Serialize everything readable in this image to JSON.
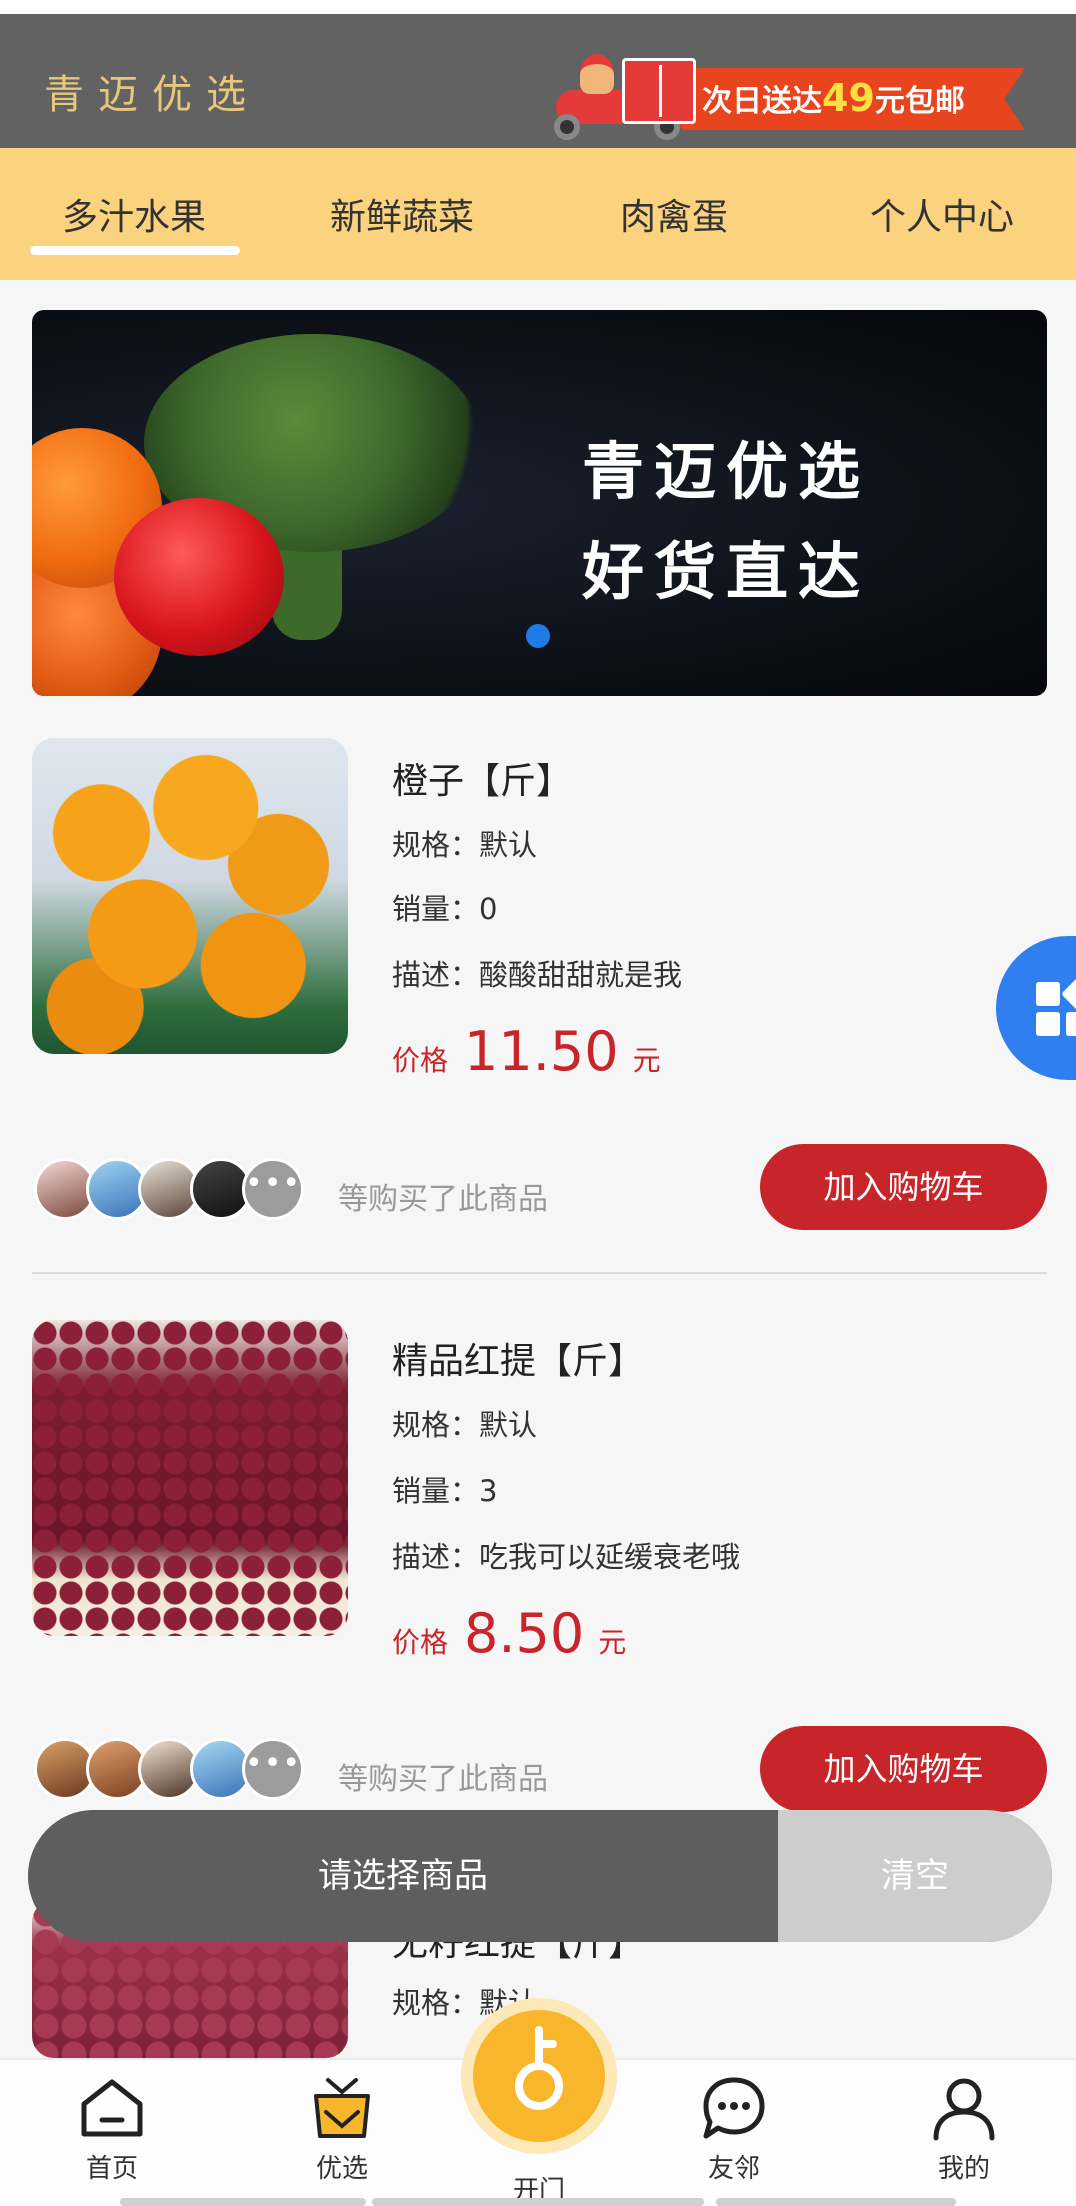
{
  "header": {
    "title": "青迈优选",
    "promo": {
      "text_before": "次日送达",
      "amount": "49",
      "text_after": "元包邮"
    }
  },
  "tabs": [
    {
      "label": "多汁水果",
      "active": true
    },
    {
      "label": "新鲜蔬菜",
      "active": false
    },
    {
      "label": "肉禽蛋",
      "active": false
    },
    {
      "label": "个人中心",
      "active": false
    }
  ],
  "banner": {
    "line1": "青迈优选",
    "line2": "好货直达",
    "slide_index": 1,
    "slide_count": 1
  },
  "products": [
    {
      "name": "橙子【斤】",
      "spec": "规格：默认",
      "sales": "销量：0",
      "desc": "描述：酸酸甜甜就是我",
      "price_label": "价格",
      "price": "11.50",
      "unit": "元",
      "buyers_text": "等购买了此商品",
      "add_label": "加入购物车"
    },
    {
      "name": "精品红提【斤】",
      "spec": "规格：默认",
      "sales": "销量：3",
      "desc": "描述：吃我可以延缓衰老哦",
      "price_label": "价格",
      "price": "8.50",
      "unit": "元",
      "buyers_text": "等购买了此商品",
      "add_label": "加入购物车"
    },
    {
      "name_partial": "无籽红提【斤】",
      "spec": "规格：默认"
    }
  ],
  "cart_bar": {
    "prompt": "请选择商品",
    "clear": "清空"
  },
  "tabbar": [
    {
      "label": "首页",
      "icon": "home-icon"
    },
    {
      "label": "优选",
      "icon": "shopping-bag-icon"
    },
    {
      "label": "开门",
      "icon": "key-icon"
    },
    {
      "label": "友邻",
      "icon": "chat-icon"
    },
    {
      "label": "我的",
      "icon": "user-icon"
    }
  ],
  "colors": {
    "header_bg": "#626262",
    "title_gold": "#e9c77a",
    "tab_bg": "#fbd37f",
    "price_red": "#c8252a",
    "fab_blue": "#2f7ff0",
    "open_gold": "#f8b62d"
  }
}
